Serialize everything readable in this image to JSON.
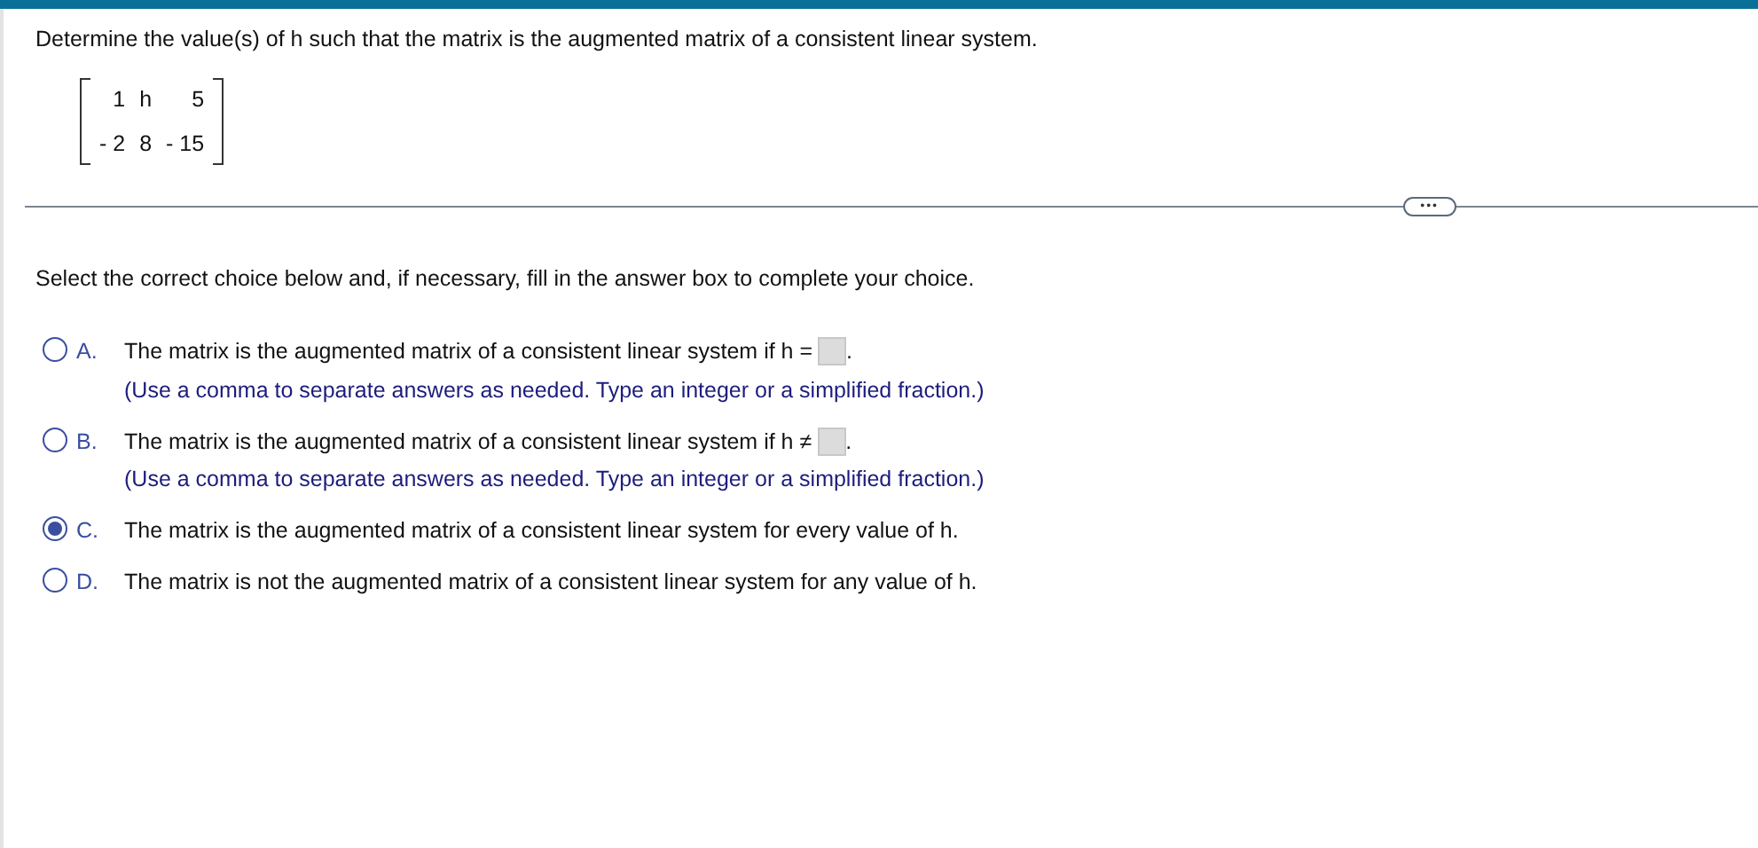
{
  "question": "Determine the value(s) of h such that the matrix is the augmented matrix of a consistent linear system.",
  "matrix": [
    [
      "1",
      "h",
      "5"
    ],
    [
      "- 2",
      "8",
      "- 15"
    ]
  ],
  "expand_button": "•••",
  "instruction": "Select the correct choice below and, if necessary, fill in the answer box to complete your choice.",
  "choices": [
    {
      "letter": "A.",
      "text": "The matrix is the augmented matrix of a consistent linear system if h =",
      "answer_box": true,
      "after": ".",
      "hint": "(Use a comma to separate answers as needed. Type an integer or a simplified fraction.)",
      "selected": false
    },
    {
      "letter": "B.",
      "text": "The matrix is the augmented matrix of a consistent linear system if h ≠",
      "answer_box": true,
      "after": ".",
      "hint": "(Use a comma to separate answers as needed. Type an integer or a simplified fraction.)",
      "selected": false
    },
    {
      "letter": "C.",
      "text": "The matrix is the augmented matrix of a consistent linear system for every value of h.",
      "answer_box": false,
      "selected": true
    },
    {
      "letter": "D.",
      "text": "The matrix is not the augmented matrix of a consistent linear system for any value of h.",
      "answer_box": false,
      "selected": false
    }
  ]
}
